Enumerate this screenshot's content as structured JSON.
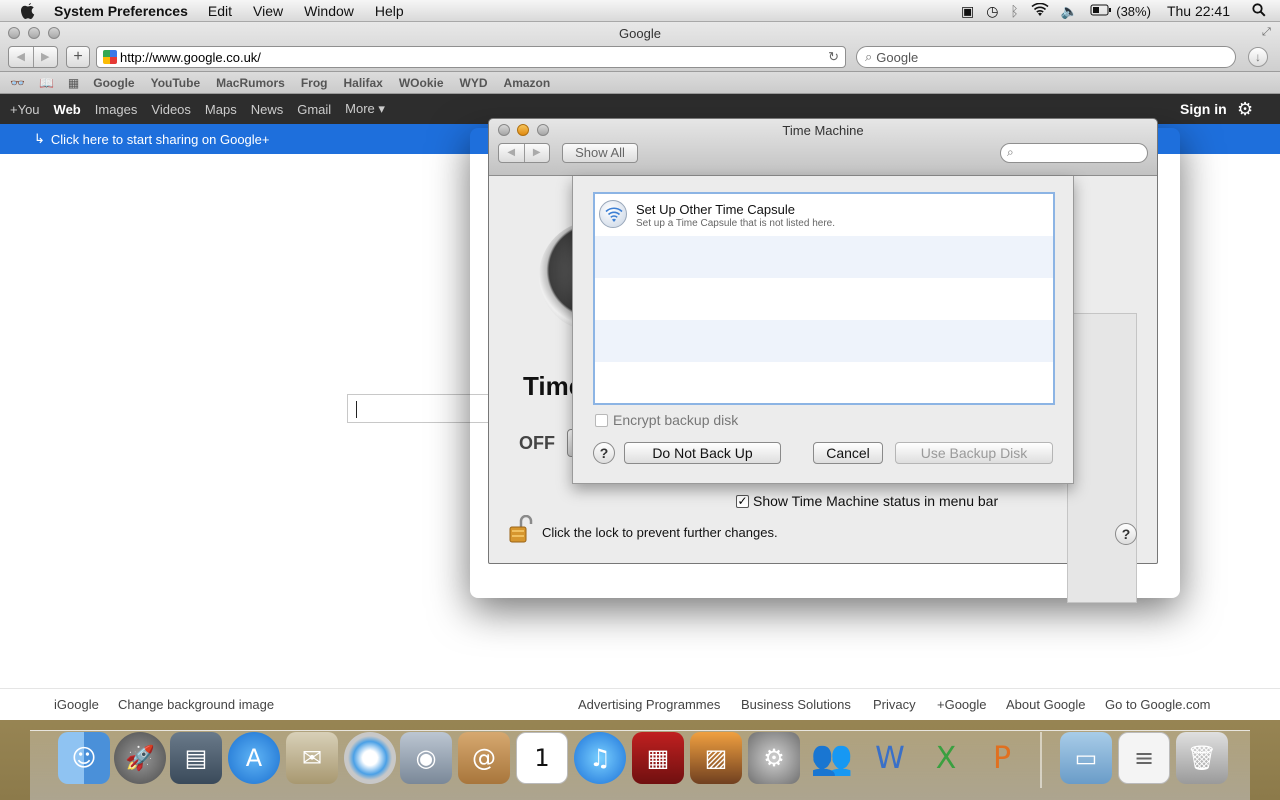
{
  "menubar": {
    "app": "System Preferences",
    "items": [
      "Edit",
      "View",
      "Window",
      "Help"
    ],
    "battery": "(38%)",
    "clock": "Thu 22:41"
  },
  "safari": {
    "title": "Google",
    "url": "http://www.google.co.uk/",
    "search_placeholder": "Google",
    "bookmarks": [
      "Google",
      "YouTube",
      "MacRumors",
      "Frog",
      "Halifax",
      "WOokie",
      "WYD",
      "Amazon"
    ]
  },
  "google": {
    "bar": [
      "+You",
      "Web",
      "Images",
      "Videos",
      "Maps",
      "News",
      "Gmail",
      "More ▾"
    ],
    "signin": "Sign in",
    "share": "Click here to start sharing on Google+",
    "footer_left": [
      "iGoogle",
      "Change background image"
    ],
    "footer_right": [
      "Advertising Programmes",
      "Business Solutions",
      "Privacy",
      "+Google",
      "About Google",
      "Go to Google.com"
    ]
  },
  "timemachine": {
    "title": "Time Machine",
    "show_all": "Show All",
    "big_label": "Time",
    "off_label": "OFF",
    "status_checkbox": "Show Time Machine status in menu bar",
    "lock_text": "Click the lock to prevent further changes.",
    "sheet": {
      "item_title": "Set Up Other Time Capsule",
      "item_subtitle": "Set up a Time Capsule that is not listed here.",
      "encrypt": "Encrypt backup disk",
      "help": "?",
      "do_not_back_up": "Do Not Back Up",
      "cancel": "Cancel",
      "use_backup_disk": "Use Backup Disk"
    }
  }
}
